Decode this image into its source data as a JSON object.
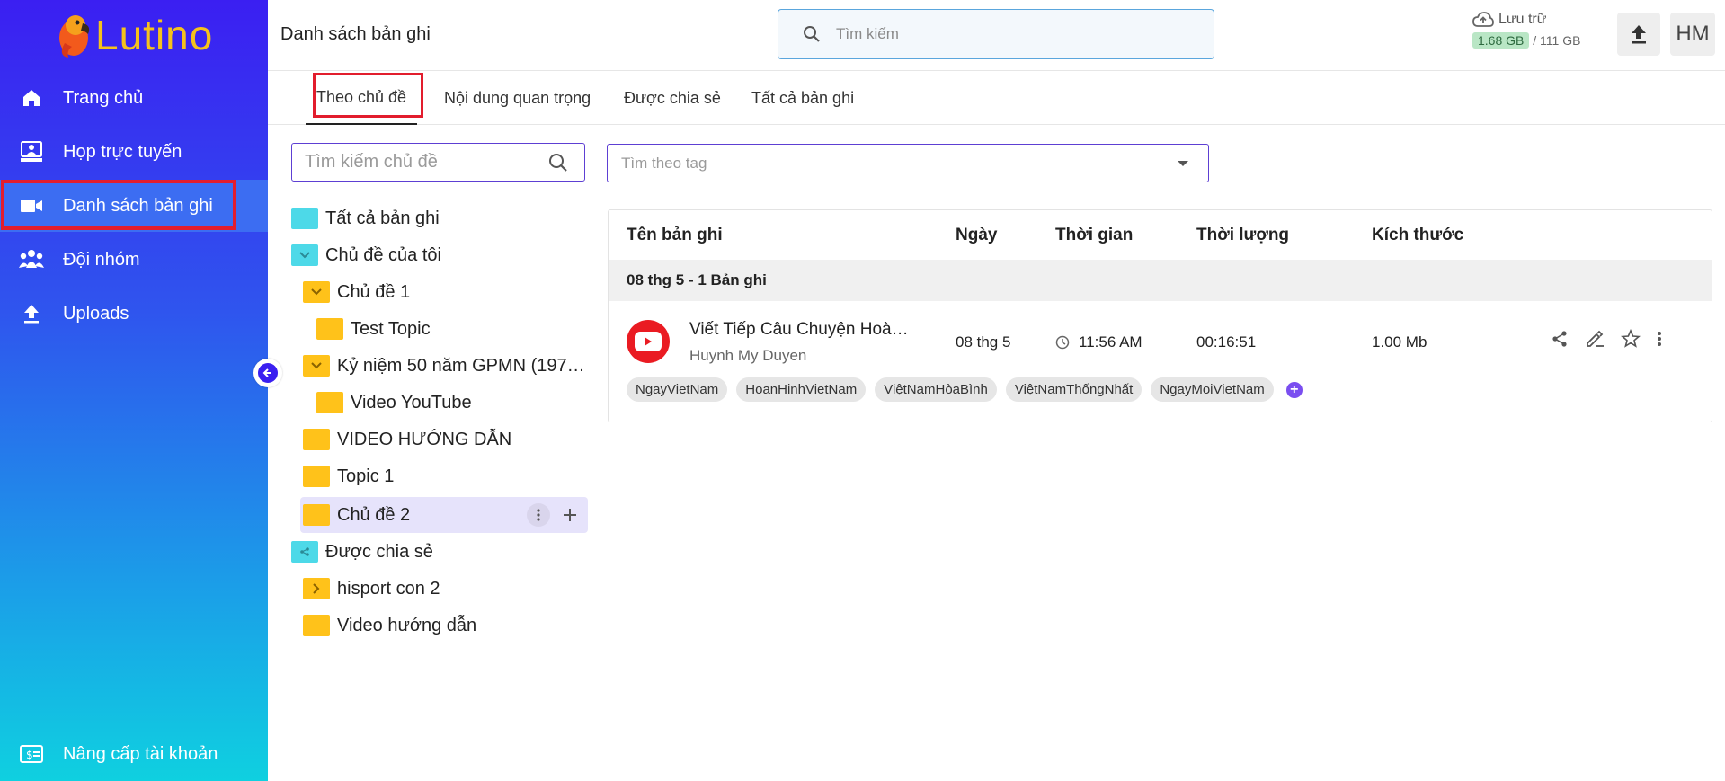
{
  "brand": {
    "name": "Lutino"
  },
  "sidebar": {
    "items": [
      {
        "label": "Trang chủ",
        "icon": "home-icon"
      },
      {
        "label": "Họp trực tuyến",
        "icon": "meeting-icon"
      },
      {
        "label": "Danh sách bản ghi",
        "icon": "video-camera-icon",
        "active": true
      },
      {
        "label": "Đội nhóm",
        "icon": "team-icon"
      },
      {
        "label": "Uploads",
        "icon": "upload-icon"
      }
    ],
    "upgrade_label": "Nâng cấp tài khoản"
  },
  "header": {
    "title": "Danh sách bản ghi",
    "search_placeholder": "Tìm kiếm",
    "storage_label": "Lưu trữ",
    "storage_used": "1.68 GB",
    "storage_total": "/ 111 GB",
    "avatar_initials": "HM"
  },
  "tabs": [
    {
      "label": "Theo chủ đề",
      "active": true
    },
    {
      "label": "Nội dung quan trọng"
    },
    {
      "label": "Được chia sẻ"
    },
    {
      "label": "Tất cả bản ghi"
    }
  ],
  "topic_search_placeholder": "Tìm kiếm chủ đề",
  "tag_search_placeholder": "Tìm theo tag",
  "tree": [
    {
      "label": "Tất cả bản ghi"
    },
    {
      "label": "Chủ đề của tôi"
    },
    {
      "label": "Chủ đề 1"
    },
    {
      "label": "Test Topic"
    },
    {
      "label": "Kỷ niệm 50 năm GPMN (197…"
    },
    {
      "label": "Video YouTube"
    },
    {
      "label": "VIDEO HƯỚNG DẪN"
    },
    {
      "label": "Topic 1"
    },
    {
      "label": "Chủ đề 2",
      "selected": true
    },
    {
      "label": "Được chia sẻ"
    },
    {
      "label": "hisport con 2"
    },
    {
      "label": "Video hướng dẫn"
    }
  ],
  "table": {
    "headers": [
      "Tên bản ghi",
      "Ngày",
      "Thời gian",
      "Thời lượng",
      "Kích thước"
    ],
    "group_label": "08 thg 5 - 1 Bản ghi",
    "record": {
      "title": "Viết Tiếp Câu Chuyện Hoà…",
      "owner": "Huynh My Duyen",
      "date": "08 thg 5",
      "time": "11:56 AM",
      "duration": "00:16:51",
      "size": "1.00 Mb",
      "tags": [
        "NgayVietNam",
        "HoanHinhVietNam",
        "ViệtNamHòaBình",
        "ViệtNamThốngNhất",
        "NgayMoiVietNam"
      ]
    }
  },
  "colors": {
    "accent": "#3b1ff2",
    "highlight_outline": "#e21d2d",
    "folder_yellow": "#ffc21a",
    "folder_cyan": "#4dd9e8"
  }
}
